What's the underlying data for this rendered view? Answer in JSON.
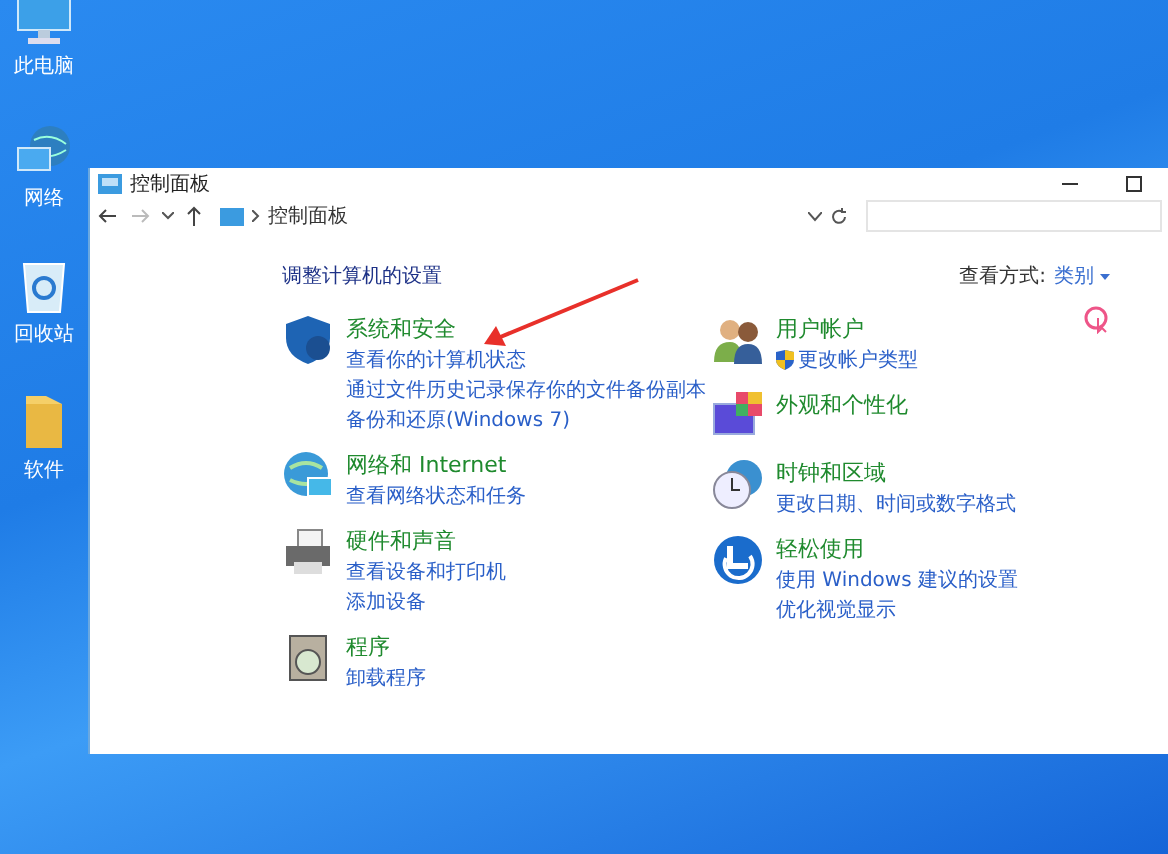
{
  "desktop_icons": [
    {
      "label": "此电脑",
      "kind": "computer"
    },
    {
      "label": "网络",
      "kind": "network"
    },
    {
      "label": "回收站",
      "kind": "recycle"
    },
    {
      "label": "软件",
      "kind": "folder"
    }
  ],
  "window": {
    "title": "控制面板",
    "breadcrumb": "控制面板",
    "heading": "调整计算机的设置",
    "view_by_label": "查看方式:",
    "view_by_value": "类别",
    "left_categories": [
      {
        "title": "系统和安全",
        "kind": "security",
        "links": [
          {
            "text": "查看你的计算机状态",
            "shield": false
          },
          {
            "text": "通过文件历史记录保存你的文件备份副本",
            "shield": false
          },
          {
            "text": "备份和还原(Windows 7)",
            "shield": false
          }
        ]
      },
      {
        "title": "网络和 Internet",
        "kind": "network",
        "links": [
          {
            "text": "查看网络状态和任务",
            "shield": false
          }
        ]
      },
      {
        "title": "硬件和声音",
        "kind": "hardware",
        "links": [
          {
            "text": "查看设备和打印机",
            "shield": false
          },
          {
            "text": "添加设备",
            "shield": false
          }
        ]
      },
      {
        "title": "程序",
        "kind": "programs",
        "links": [
          {
            "text": "卸载程序",
            "shield": false
          }
        ]
      }
    ],
    "right_categories": [
      {
        "title": "用户帐户",
        "kind": "users",
        "links": [
          {
            "text": "更改帐户类型",
            "shield": true
          }
        ]
      },
      {
        "title": "外观和个性化",
        "kind": "appearance"
      },
      {
        "title": "时钟和区域",
        "kind": "clock",
        "links": [
          {
            "text": "更改日期、时间或数字格式",
            "shield": false
          }
        ]
      },
      {
        "title": "轻松使用",
        "kind": "ease",
        "links": [
          {
            "text": "使用 Windows 建议的设置",
            "shield": false
          },
          {
            "text": "优化视觉显示",
            "shield": false
          }
        ]
      }
    ]
  }
}
